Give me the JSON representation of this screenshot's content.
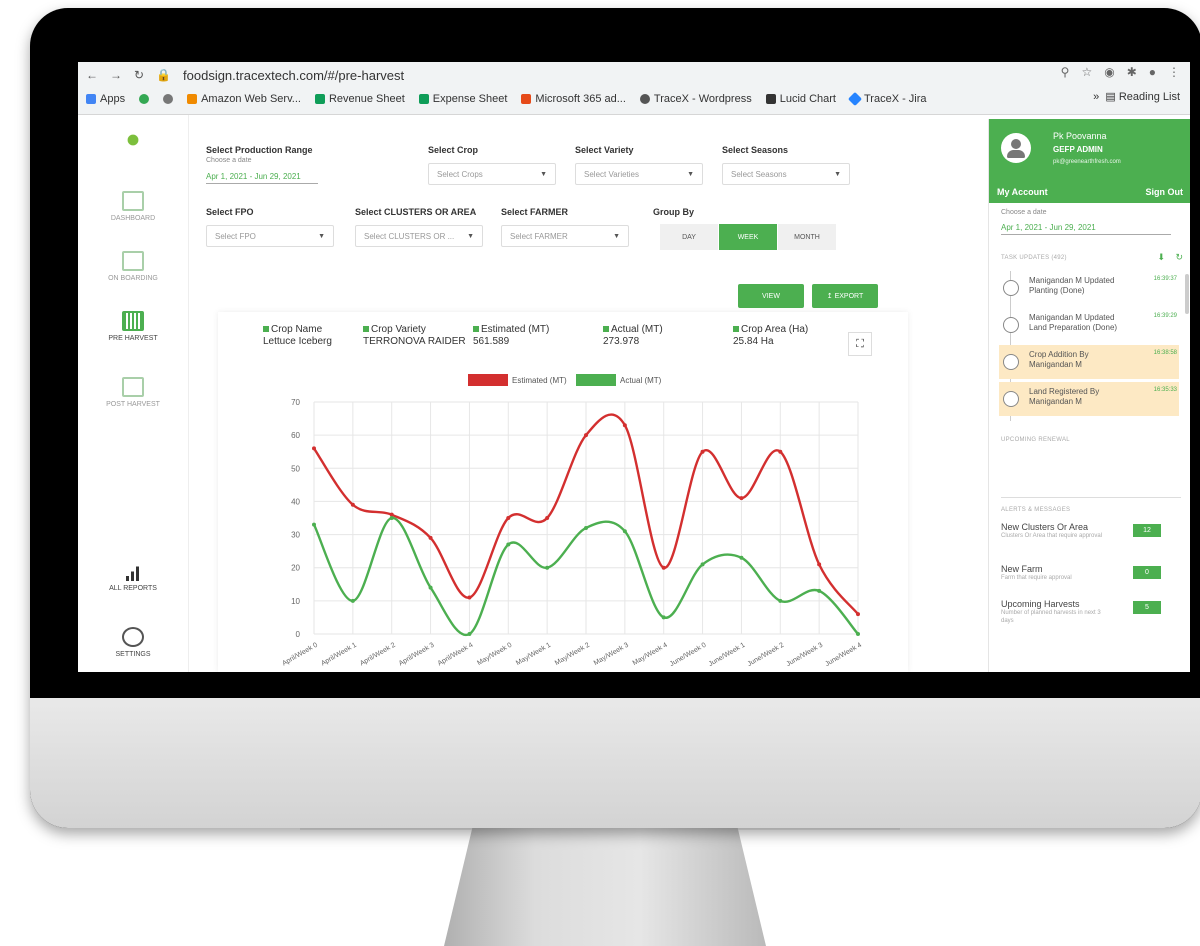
{
  "browser": {
    "url": "foodsign.tracextech.com/#/pre-harvest",
    "reading_list": "Reading List",
    "bookmarks": [
      "Apps",
      "Amazon Web Serv...",
      "Revenue Sheet",
      "Expense Sheet",
      "Microsoft 365 ad...",
      "TraceX - Wordpress",
      "Lucid Chart",
      "TraceX - Jira"
    ]
  },
  "sidebar": {
    "items": [
      {
        "label": "DASHBOARD"
      },
      {
        "label": "ON BOARDING"
      },
      {
        "label": "PRE HARVEST"
      },
      {
        "label": "POST HARVEST"
      },
      {
        "label": "ALL REPORTS"
      },
      {
        "label": "SETTINGS"
      }
    ]
  },
  "filters": {
    "production_range": {
      "label": "Select Production Range",
      "sub": "Choose a date",
      "value": "Apr 1, 2021 - Jun 29, 2021"
    },
    "crop": {
      "label": "Select Crop",
      "placeholder": "Select Crops"
    },
    "variety": {
      "label": "Select Variety",
      "placeholder": "Select Varieties"
    },
    "seasons": {
      "label": "Select Seasons",
      "placeholder": "Select Seasons"
    },
    "fpo": {
      "label": "Select FPO",
      "placeholder": "Select FPO"
    },
    "clusters": {
      "label": "Select CLUSTERS OR AREA",
      "placeholder": "Select CLUSTERS OR ..."
    },
    "farmer": {
      "label": "Select FARMER",
      "placeholder": "Select FARMER"
    },
    "group_by": {
      "label": "Group By",
      "options": [
        "DAY",
        "WEEK",
        "MONTH"
      ],
      "selected": "WEEK"
    },
    "view_label": "VIEW",
    "export_label": "EXPORT"
  },
  "summary": {
    "crop_name_label": "Crop Name",
    "crop_name": "Lettuce Iceberg",
    "crop_variety_label": "Crop Variety",
    "crop_variety": "TERRONOVA RAIDER",
    "estimated_label": "Estimated (MT)",
    "estimated": "561.589",
    "actual_label": "Actual (MT)",
    "actual": "273.978",
    "area_label": "Crop Area (Ha)",
    "area": "25.84 Ha"
  },
  "chart_data": {
    "type": "line",
    "categories": [
      "April/Week 0",
      "April/Week 1",
      "April/Week 2",
      "April/Week 3",
      "April/Week 4",
      "May/Week 0",
      "May/Week 1",
      "May/Week 2",
      "May/Week 3",
      "May/Week 4",
      "June/Week 0",
      "June/Week 1",
      "June/Week 2",
      "June/Week 3",
      "June/Week 4"
    ],
    "series": [
      {
        "name": "Estimated (MT)",
        "color": "#d32f2f",
        "values": [
          56,
          39,
          36,
          29,
          11,
          35,
          35,
          60,
          63,
          20,
          55,
          41,
          55,
          21,
          6
        ]
      },
      {
        "name": "Actual (MT)",
        "color": "#4caf50",
        "values": [
          33,
          10,
          35,
          14,
          0,
          27,
          20,
          32,
          31,
          5,
          21,
          23,
          10,
          13,
          0
        ]
      }
    ],
    "ylim": [
      0,
      70
    ],
    "yticks": [
      0,
      10,
      20,
      30,
      40,
      50,
      60,
      70
    ],
    "grid": true,
    "legend": "top-center"
  },
  "account": {
    "name": "Pk Poovanna",
    "role": "GEFP ADMIN",
    "email": "pk@greenearthfresh.com",
    "my_account": "My Account",
    "sign_out": "Sign Out",
    "date_sub": "Choose a date",
    "date_value": "Apr 1, 2021 - Jun 29, 2021",
    "task_updates": "TASK UPDATES (492)",
    "feed": [
      {
        "text": "Manigandan M Updated Planting (Done)",
        "time": "16:39:37"
      },
      {
        "text": "Manigandan M Updated Land Preparation (Done)",
        "time": "16:39:29"
      },
      {
        "text": "Crop Addition By Manigandan M",
        "time": "16:38:58"
      },
      {
        "text": "Land Registered By Manigandan M",
        "time": "16:35:33"
      }
    ],
    "upcoming": "UPCOMING RENEWAL",
    "messages_title": "ALERTS & MESSAGES",
    "messages": [
      {
        "title": "New Clusters Or Area",
        "desc": "Clusters Or Area that require approval",
        "count": "12"
      },
      {
        "title": "New Farm",
        "desc": "Farm that require approval",
        "count": "0"
      },
      {
        "title": "Upcoming Harvests",
        "desc": "Number of planned harvests in next 3 days",
        "count": "5"
      }
    ]
  }
}
